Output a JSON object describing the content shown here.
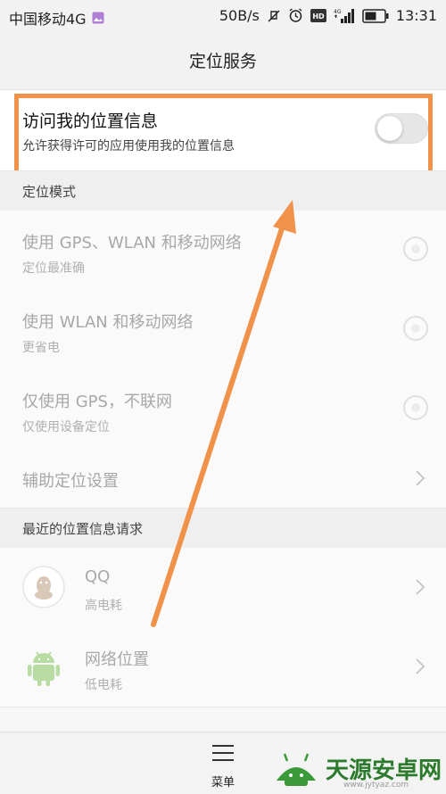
{
  "status_bar": {
    "carrier": "中国移动4G",
    "speed": "50B/s",
    "network": "4G",
    "hd": "HD",
    "time": "13:31",
    "icons": [
      "gallery-icon",
      "mute-icon",
      "alarm-icon",
      "hd-icon",
      "signal-icon",
      "battery-icon"
    ]
  },
  "header": {
    "title": "定位服务"
  },
  "location_access": {
    "title": "访问我的位置信息",
    "subtitle": "允许获得许可的应用使用我的位置信息",
    "toggle_on": false
  },
  "mode_section": {
    "header": "定位模式",
    "options": [
      {
        "title": "使用 GPS、WLAN 和移动网络",
        "subtitle": "定位最准确"
      },
      {
        "title": "使用 WLAN 和移动网络",
        "subtitle": "更省电"
      },
      {
        "title": "仅使用 GPS，不联网",
        "subtitle": "仅使用设备定位"
      }
    ],
    "assist": "辅助定位设置"
  },
  "recent_section": {
    "header": "最近的位置信息请求",
    "apps": [
      {
        "name": "QQ",
        "usage": "高电耗",
        "icon": "qq-penguin-icon"
      },
      {
        "name": "网络位置",
        "usage": "低电耗",
        "icon": "android-icon"
      }
    ]
  },
  "bottom_bar": {
    "menu_label": "菜单"
  },
  "watermark": {
    "text": "天源安卓网",
    "url": "www.jytyaz.com"
  },
  "colors": {
    "annotation": "#f0924a",
    "disabled_text": "#a8a8a8",
    "watermark_green": "#2c7a2c"
  }
}
